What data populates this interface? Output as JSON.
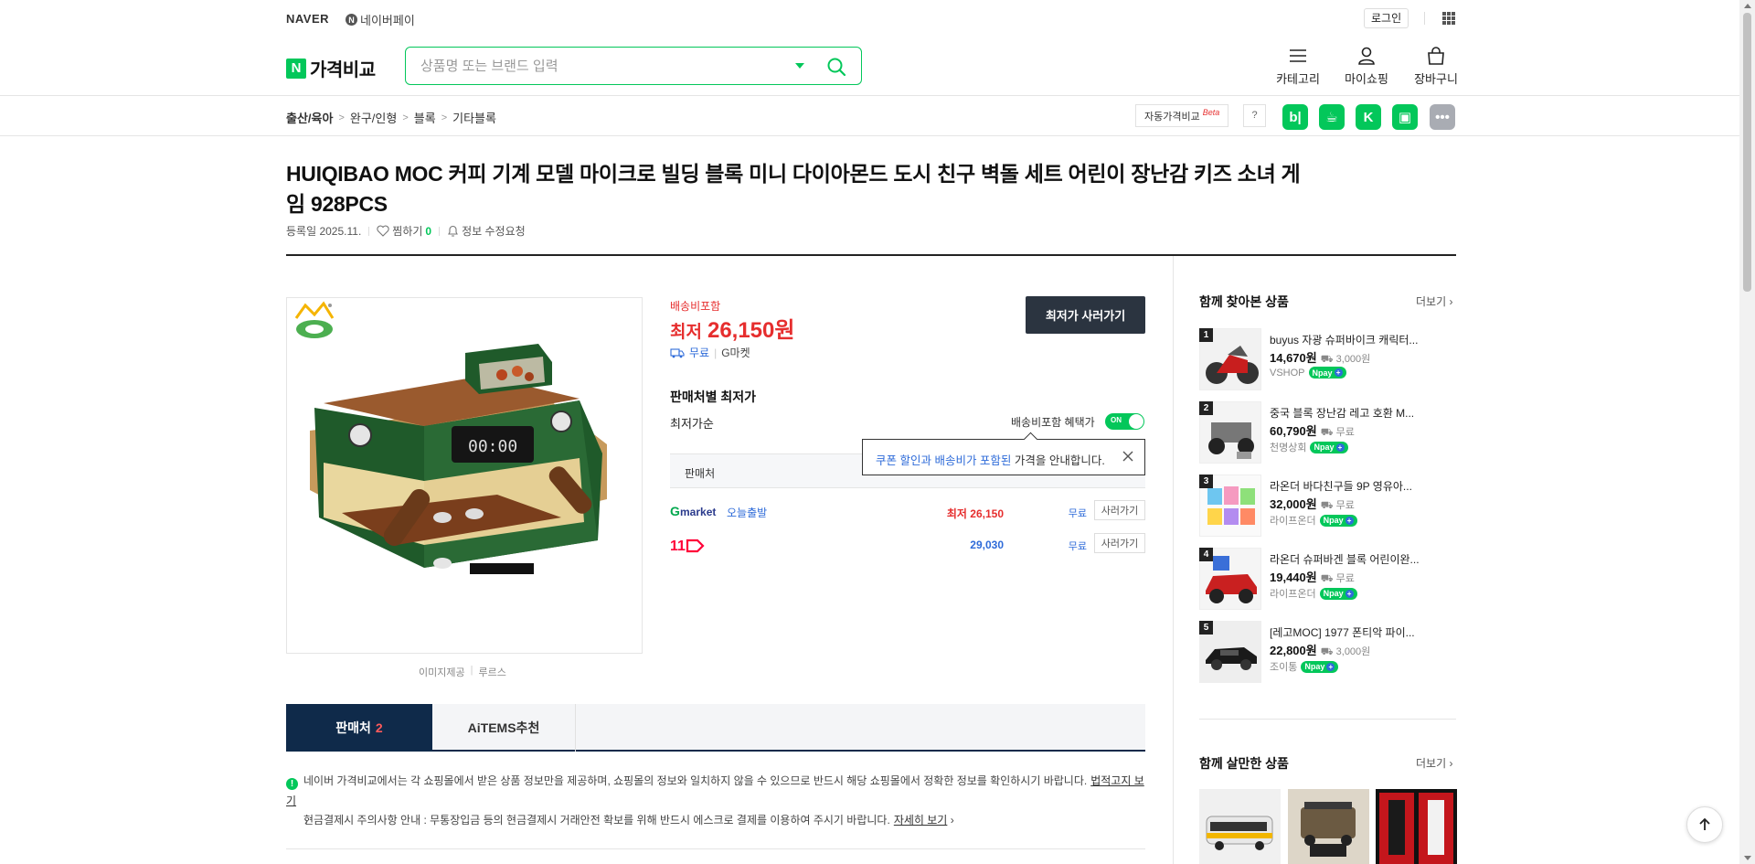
{
  "topbar": {
    "naver": "NAVER",
    "npay": "네이버페이",
    "npay_badge": "N",
    "login": "로그인"
  },
  "header": {
    "brand_n": "N",
    "brand": "가격비교",
    "search_placeholder": "상품명 또는 브랜드 입력",
    "menu": [
      {
        "label": "카테고리",
        "icon": "hamburger-icon"
      },
      {
        "label": "마이쇼핑",
        "icon": "person-icon"
      },
      {
        "label": "장바구니",
        "icon": "bag-icon"
      }
    ]
  },
  "breadcrumb": [
    "출산/육아",
    "완구/인형",
    "블록",
    "기타블록"
  ],
  "breadcrumb_sep": ">",
  "auto_compare": {
    "label": "자동가격비교",
    "beta": "Beta",
    "help": "?"
  },
  "share": [
    {
      "name": "blog-share-icon",
      "glyph": "b|"
    },
    {
      "name": "cafe-share-icon",
      "glyph": "☕"
    },
    {
      "name": "talk-share-icon",
      "glyph": "K"
    },
    {
      "name": "band-share-icon",
      "glyph": "▣"
    },
    {
      "name": "more-share-icon",
      "glyph": "•••"
    }
  ],
  "product": {
    "title": "HUIQIBAO MOC 커피 기계 모델 마이크로 빌딩 블록 미니 다이아몬드 도시 친구 벽돌 세트 어린이 장난감 키즈 소녀 게임 928PCS",
    "registered": "등록일 2025.11.",
    "like_label": "찜하기",
    "like_count": "0",
    "edit_request": "정보 수정요청",
    "image_credit_label": "이미지제공",
    "image_credit_source": "루르스"
  },
  "price": {
    "shipping_included": "배송비포함",
    "lowest_label": "최저",
    "lowest_value": "26,150원",
    "shipping": "무료",
    "mall": "G마켓",
    "buy_button": "최저가 사러가기"
  },
  "sellers": {
    "title": "판매처별 최저가",
    "sort": "최저가순",
    "toggle_label": "배송비포함 혜택가",
    "toggle_state": "ON",
    "table_header": "판매처",
    "tooltip_highlight": "쿠폰 할인과 배송비가 포함된",
    "tooltip_rest": " 가격을 안내합니다.",
    "rows": [
      {
        "mall": "Gmarket",
        "tag": "오늘출발",
        "price": "최저 26,150",
        "shipping": "무료",
        "button": "사러가기"
      },
      {
        "mall": "11번가",
        "tag": "",
        "price": "29,030",
        "shipping": "무료",
        "button": "사러가기"
      }
    ]
  },
  "tabs": [
    {
      "label": "판매처",
      "count": "2"
    },
    {
      "label": "AiTEMS추천"
    }
  ],
  "notice": {
    "line1": "네이버 가격비교에서는 각 쇼핑몰에서 받은 상품 정보만을 제공하며, 쇼핑몰의 정보와 일치하지 않을 수 있으므로 반드시 해당 쇼핑몰에서 정확한 정보를 확인하시기 바랍니다.",
    "line1_link": "법적고지 보기",
    "line2": "현금결제시 주의사항 안내 : 무통장입금 등의 현금결제시 거래안전 확보를 위해 반드시 에스크로 결제를 이용하여 주시기 바랍니다.",
    "line2_link": "자세히 보기"
  },
  "related": {
    "title": "함께 찾아본 상품",
    "more": "더보기",
    "items": [
      {
        "rank": "1",
        "name": "buyus 자광 슈퍼바이크 캐릭터...",
        "price": "14,670원",
        "ship": "3,000원",
        "mall": "VSHOP",
        "npay": true
      },
      {
        "rank": "2",
        "name": "중국 블록 장난감 레고 호환 M...",
        "price": "60,790원",
        "ship": "무료",
        "mall": "천명상회",
        "npay": true
      },
      {
        "rank": "3",
        "name": "라온더 바다친구들 9P 영유아...",
        "price": "32,000원",
        "ship": "무료",
        "mall": "라이프온더",
        "npay": true
      },
      {
        "rank": "4",
        "name": "라온더 슈퍼바겐 블록 어린이완...",
        "price": "19,440원",
        "ship": "무료",
        "mall": "라이프온더",
        "npay": true
      },
      {
        "rank": "5",
        "name": "[레고MOC] 1977 폰티악 파이...",
        "price": "22,800원",
        "ship": "3,000원",
        "mall": "조이통",
        "npay": true
      }
    ],
    "npay_label": "pay"
  },
  "bought_together": {
    "title": "함께 살만한 상품",
    "more": "더보기"
  },
  "colors": {
    "naver_green": "#03c75a",
    "price_red": "#e62e2e",
    "link_blue": "#2e6bd9",
    "tab_navy": "#0f2a4a",
    "button_dark": "#2b3440"
  }
}
